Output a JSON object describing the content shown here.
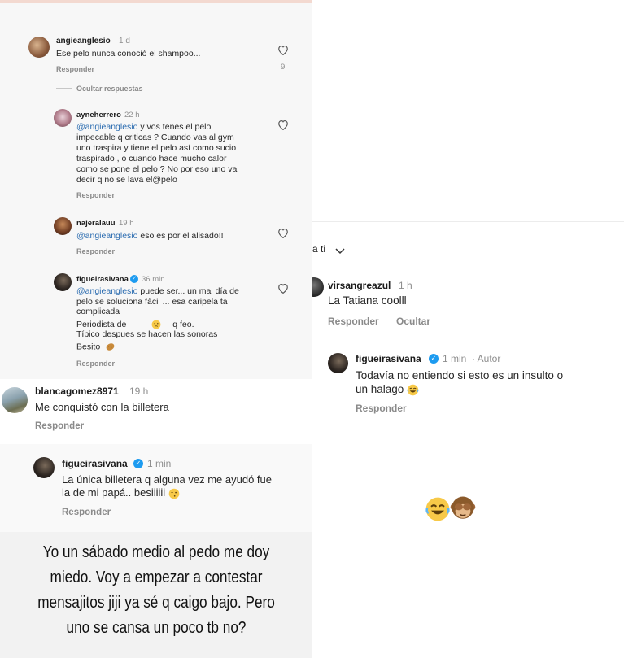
{
  "panel1": {
    "comment_angie": {
      "username": "angieanglesio",
      "time": "1 d",
      "text": "Ese pelo nunca conoció el shampoo...",
      "reply_label": "Responder",
      "likes": "9"
    },
    "hide_replies_label": "Ocultar respuestas",
    "reply_ayne": {
      "username": "ayneherrero",
      "time": "22 h",
      "mention": "@angieanglesio",
      "line1": " y vos tenes el pelo",
      "line2": "impecable q criticas ? Cuando vas al gym",
      "line3": "uno traspira y tiene el pelo así como sucio",
      "line4": "traspirado , o cuando hace mucho calor",
      "line5": "como se pone el pelo ?  No por eso uno va",
      "line6": "decir q no se lava el@pelo",
      "reply_label": "Responder"
    },
    "reply_najera": {
      "username": "najeralauu",
      "time": "19 h",
      "mention": "@angieanglesio",
      "text": " eso es por el alisado!!",
      "reply_label": "Responder"
    },
    "reply_figueira": {
      "username": "figueirasivana",
      "time": "36 min",
      "mention": "@angieanglesio",
      "line1": " puede ser... un mal día de",
      "line2": "pelo se soluciona fácil ... esa caripela ta",
      "line3": "complicada",
      "line4a": "Periodista de",
      "line4b": "q feo.",
      "line5": "Típico despues se hacen las sonoras",
      "line6": "Besito",
      "reply_label": "Responder"
    }
  },
  "panel2": {
    "comment_blanca": {
      "username": "blancagomez8971",
      "time": "19 h",
      "text": "Me conquistó con la billetera",
      "reply_label": "Responder"
    },
    "reply_figueira": {
      "username": "figueirasivana",
      "time": "1 min",
      "line1": "La única billetera q alguna vez me ayudó fue",
      "line2": "la de mi papá.. besiiiiii",
      "reply_label": "Responder"
    }
  },
  "story_text": {
    "line1": "Yo un sábado medio al pedo me doy",
    "line2": "miedo. Voy a empezar a contestar",
    "line3": "mensajitos jiji ya sé q caigo bajo. Pero",
    "line4": "uno se cansa un poco tb no?"
  },
  "panel6": {
    "sort_label": "a ti",
    "comment_virsan": {
      "username": "virsangreazul",
      "time": "1 h",
      "text": "La Tatiana coolll",
      "reply_label": "Responder",
      "hide_label": "Ocultar"
    },
    "reply_figueira": {
      "username": "figueirasivana",
      "time": "1 min",
      "author_badge": "Autor",
      "line1": "Todavía no entiendo si esto es un insulto o",
      "line2": "un halago",
      "reply_label": "Responder"
    }
  },
  "colors": {
    "mention": "#2b6cb0",
    "verified": "#1d9bf0",
    "muted_text": "#8e8e8e"
  },
  "icons": [
    "heart-icon",
    "verified-icon",
    "chevron-down-icon",
    "thinking-emoji",
    "potato-emoji",
    "kiss-emoji",
    "laughing-emoji",
    "see-no-evil-monkey-emoji"
  ]
}
